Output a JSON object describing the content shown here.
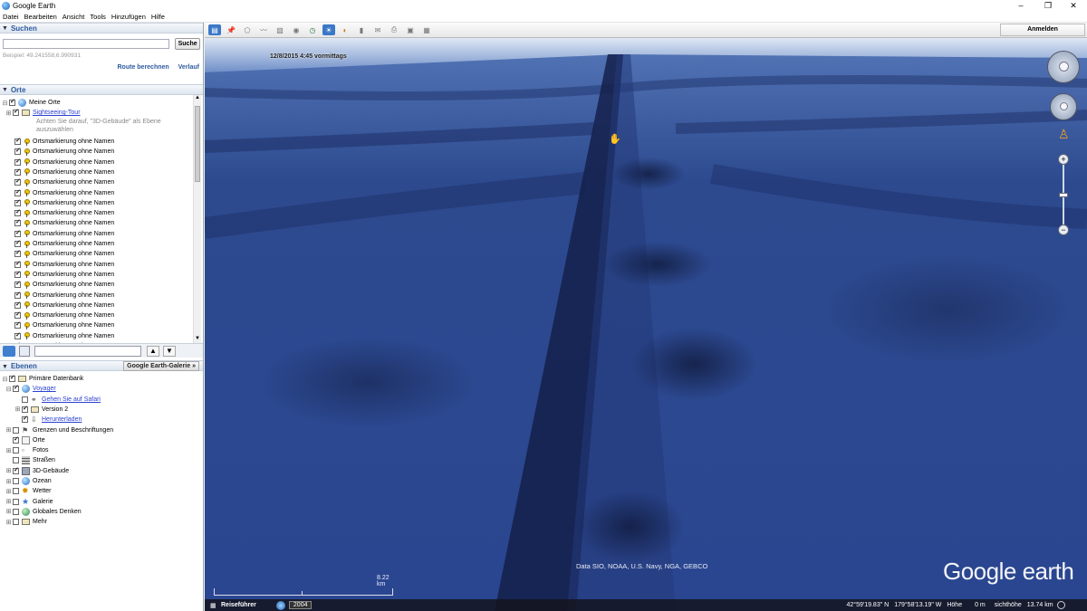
{
  "window": {
    "title": "Google Earth",
    "controls": [
      "–",
      "❐",
      "✕"
    ]
  },
  "menu": [
    "Datei",
    "Bearbeiten",
    "Ansicht",
    "Tools",
    "Hinzufügen",
    "Hilfe"
  ],
  "search": {
    "header": "Suchen",
    "button": "Suche",
    "example": "Beispiel: 49.241558,6.990931",
    "links": [
      "Route berechnen",
      "Verlauf"
    ]
  },
  "places": {
    "header": "Orte",
    "root": "Meine Orte",
    "tour": {
      "title": "Sightseeing-Tour",
      "hint1": "Achten Sie darauf, \"3D-Gebäude\" als Ebene",
      "hint2": "auszuwählen"
    },
    "placemark_label": "Ortsmarkierung ohne Namen",
    "placemarks": [
      "Ortsmarkierung ohne Namen",
      "Ortsmarkierung ohne Namen",
      "Ortsmarkierung ohne Namen",
      "Ortsmarkierung ohne Namen",
      "Ortsmarkierung ohne Namen",
      "Ortsmarkierung ohne Namen",
      "Ortsmarkierung ohne Namen",
      "Ortsmarkierung ohne Namen",
      "Ortsmarkierung ohne Namen",
      "Ortsmarkierung ohne Namen",
      "Ortsmarkierung ohne Namen",
      "Ortsmarkierung ohne Namen",
      "Ortsmarkierung ohne Namen",
      "Ortsmarkierung ohne Namen",
      "Ortsmarkierung ohne Namen",
      "Ortsmarkierung ohne Namen",
      "Ortsmarkierung ohne Namen",
      "Ortsmarkierung ohne Namen",
      "Ortsmarkierung ohne Namen",
      "Ortsmarkierung ohne Namen",
      "Ortsmarkierung ohne Namen",
      "Ortsmarkierung ohne Namen"
    ]
  },
  "layers": {
    "header": "Ebenen",
    "gallery_button": "Google Earth-Galerie",
    "items": [
      {
        "label": "Primäre Datenbank",
        "checked": true,
        "link": false
      },
      {
        "label": "Voyager",
        "checked": true,
        "link": true
      },
      {
        "label": "Gehen Sie auf Safari",
        "checked": false,
        "link": true
      },
      {
        "label": "Version 2",
        "checked": true,
        "link": false
      },
      {
        "label": "Herunterladen",
        "checked": true,
        "link": true
      },
      {
        "label": "Grenzen und Beschriftungen",
        "checked": false,
        "link": false
      },
      {
        "label": "Orte",
        "checked": true,
        "link": false
      },
      {
        "label": "Fotos",
        "checked": false,
        "link": false
      },
      {
        "label": "Straßen",
        "checked": false,
        "link": false
      },
      {
        "label": "3D-Gebäude",
        "checked": true,
        "link": false
      },
      {
        "label": "Ozean",
        "checked": false,
        "link": false
      },
      {
        "label": "Wetter",
        "checked": false,
        "link": false
      },
      {
        "label": "Galerie",
        "checked": false,
        "link": false
      },
      {
        "label": "Globales Denken",
        "checked": false,
        "link": false
      },
      {
        "label": "Mehr",
        "checked": false,
        "link": false
      }
    ]
  },
  "toolbar": {
    "signin": "Anmelden"
  },
  "map": {
    "date_overlay": "12/8/2015 4:45 vormittags",
    "attribution": "Data SIO, NOAA, U.S. Navy, NGA, GEBCO",
    "scale_label": "8.22 km",
    "logo": "Google earth"
  },
  "status": {
    "tour_guide": "Reiseführer",
    "year": "2004",
    "lat": "42°59'19.83\" N",
    "lon": "179°58'13.19\" W",
    "elev_label": "Höhe",
    "elev_value": "0 m",
    "eye_label": "sichthöhe",
    "eye_value": "13.74 km"
  },
  "colors": {
    "ocean_light": "#4a6fb8",
    "ocean_dark": "#1d2f66",
    "panel_title": "#2d5aa0",
    "link": "#2a40d0"
  }
}
